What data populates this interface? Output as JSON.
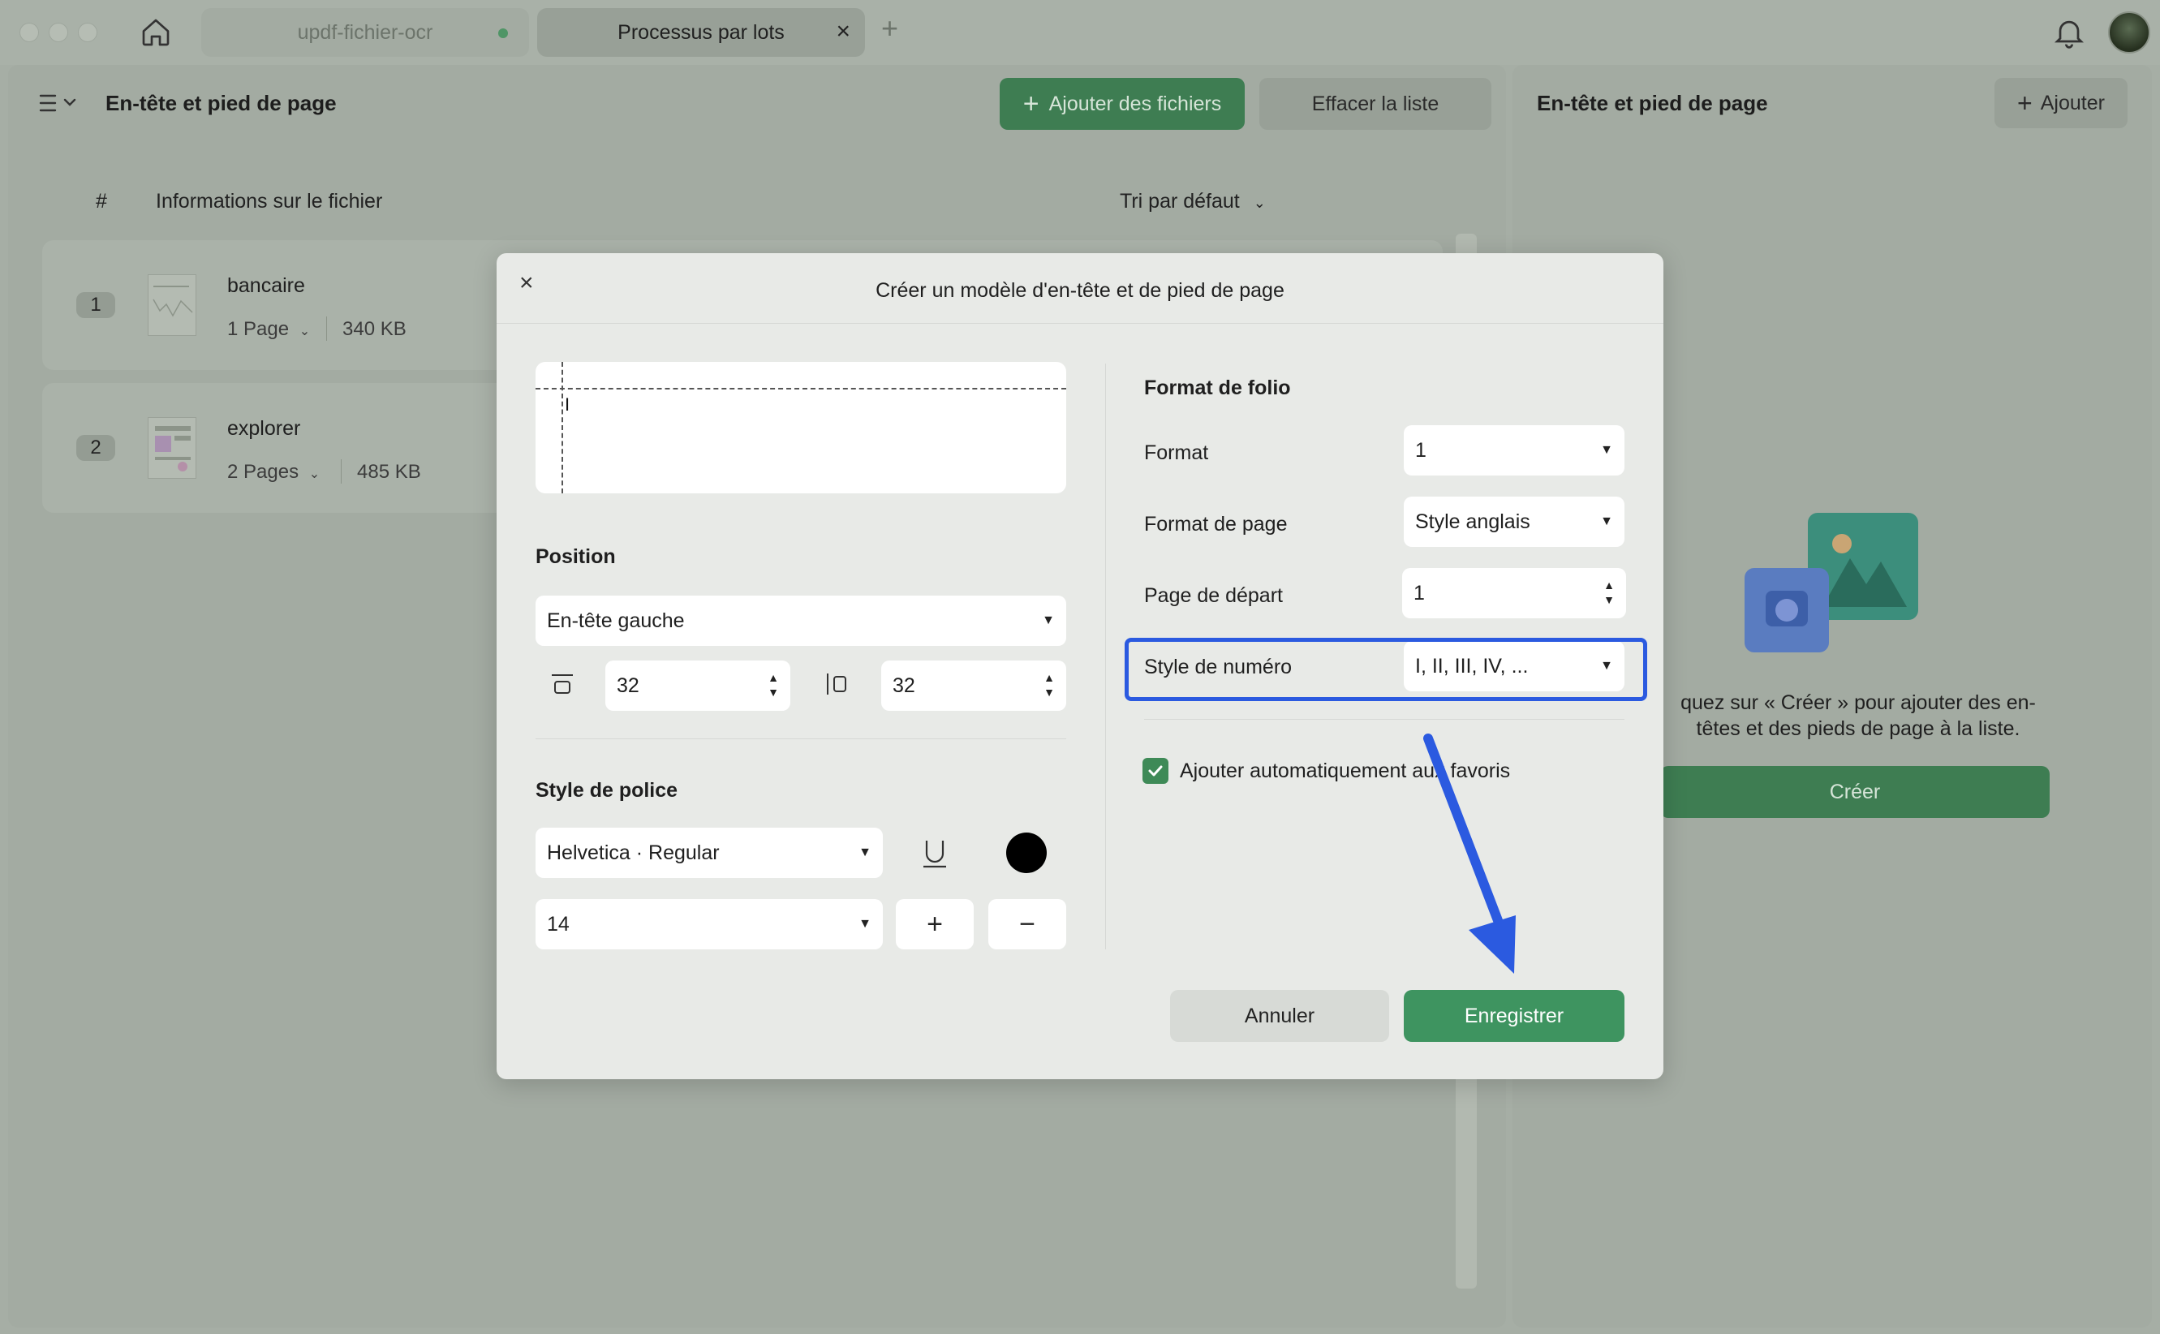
{
  "tabs": [
    {
      "label": "updf-fichier-ocr"
    },
    {
      "label": "Processus par lots"
    }
  ],
  "left_panel": {
    "title": "En-tête et pied de page",
    "add_files_label": "Ajouter des fichiers",
    "clear_list_label": "Effacer la liste",
    "columns": {
      "number": "#",
      "info": "Informations sur le fichier"
    },
    "sort_label": "Tri par défaut",
    "files": [
      {
        "index": "1",
        "name": "bancaire",
        "pages": "1 Page",
        "size": "340 KB"
      },
      {
        "index": "2",
        "name": "explorer",
        "pages": "2 Pages",
        "size": "485 KB"
      }
    ]
  },
  "right_panel": {
    "title": "En-tête et pied de page",
    "add_label": "Ajouter",
    "hint_line1": "quez sur « Créer » pour ajouter des en-",
    "hint_line2": "têtes et des pieds de page à la liste.",
    "create_label": "Créer"
  },
  "modal": {
    "title": "Créer un modèle d'en-tête et de pied de page",
    "preview_caret": "I",
    "position_label": "Position",
    "position_value": "En-tête gauche",
    "margin_top": "32",
    "margin_side": "32",
    "font_style_label": "Style de police",
    "font_value": "Helvetica · Regular",
    "font_size": "14",
    "plus": "+",
    "minus": "−",
    "folio_label": "Format de folio",
    "format_label": "Format",
    "format_value": "1",
    "page_format_label": "Format de page",
    "page_format_value": "Style anglais",
    "start_page_label": "Page de départ",
    "start_page_value": "1",
    "number_style_label": "Style de numéro",
    "number_style_value": "I, II, III, IV, ...",
    "auto_favorites_label": "Ajouter automatiquement aux favoris",
    "cancel_label": "Annuler",
    "save_label": "Enregistrer"
  },
  "colors": {
    "accent_green": "#3e9460",
    "highlight_blue": "#2b5ae0"
  }
}
